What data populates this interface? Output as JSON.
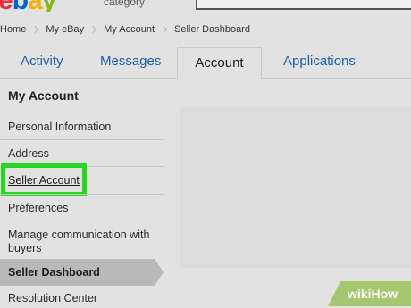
{
  "header": {
    "logo_text": "ebay",
    "category_text": "category"
  },
  "breadcrumb": [
    "Home",
    "My eBay",
    "My Account",
    "Seller Dashboard"
  ],
  "tabs": [
    {
      "label": "Activity",
      "active": false
    },
    {
      "label": "Messages",
      "active": false
    },
    {
      "label": "Account",
      "active": true
    },
    {
      "label": "Applications",
      "active": false
    }
  ],
  "sidebar": {
    "title": "My Account",
    "items": [
      {
        "label": "Personal Information"
      },
      {
        "label": "Address"
      },
      {
        "label": "Seller Account",
        "highlighted": true
      },
      {
        "label": "Preferences"
      },
      {
        "label": "Manage communication with buyers"
      },
      {
        "label": "Seller Dashboard",
        "selected": true
      },
      {
        "label": "Resolution Center"
      }
    ]
  },
  "watermark": {
    "text": "wikiHow"
  },
  "colors": {
    "background": "#e2e2e2",
    "tab_link": "#1c5fa6",
    "highlight": "#2bd424",
    "selected_item": "#b9b9b9",
    "watermark_green": "#9bc25a"
  }
}
